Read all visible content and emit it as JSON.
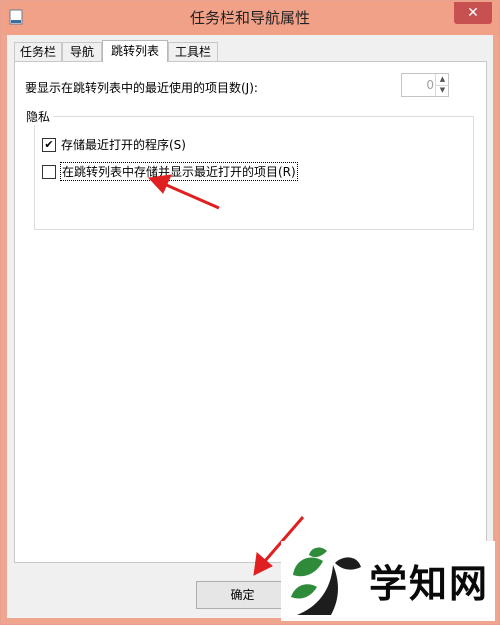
{
  "window": {
    "title": "任务栏和导航属性",
    "close_label": "✕"
  },
  "tabs": [
    {
      "label": "任务栏",
      "active": false
    },
    {
      "label": "导航",
      "active": false
    },
    {
      "label": "跳转列表",
      "active": true
    },
    {
      "label": "工具栏",
      "active": false
    }
  ],
  "jumplist": {
    "recent_items_label": "要显示在跳转列表中的最近使用的项目数(J):",
    "recent_items_value": "0",
    "privacy_group_title": "隐私",
    "store_programs_label": "存储最近打开的程序(S)",
    "store_programs_checked": true,
    "store_items_label": "在跳转列表中存储并显示最近打开的项目(R)",
    "store_items_checked": false
  },
  "footer": {
    "ok_label": "确定"
  },
  "watermark": {
    "text": "学知网"
  },
  "colors": {
    "titlebar": "#f2a189",
    "close_button": "#c75050",
    "annotation_arrow": "#e02020",
    "watermark_green": "#2e8b3a"
  }
}
